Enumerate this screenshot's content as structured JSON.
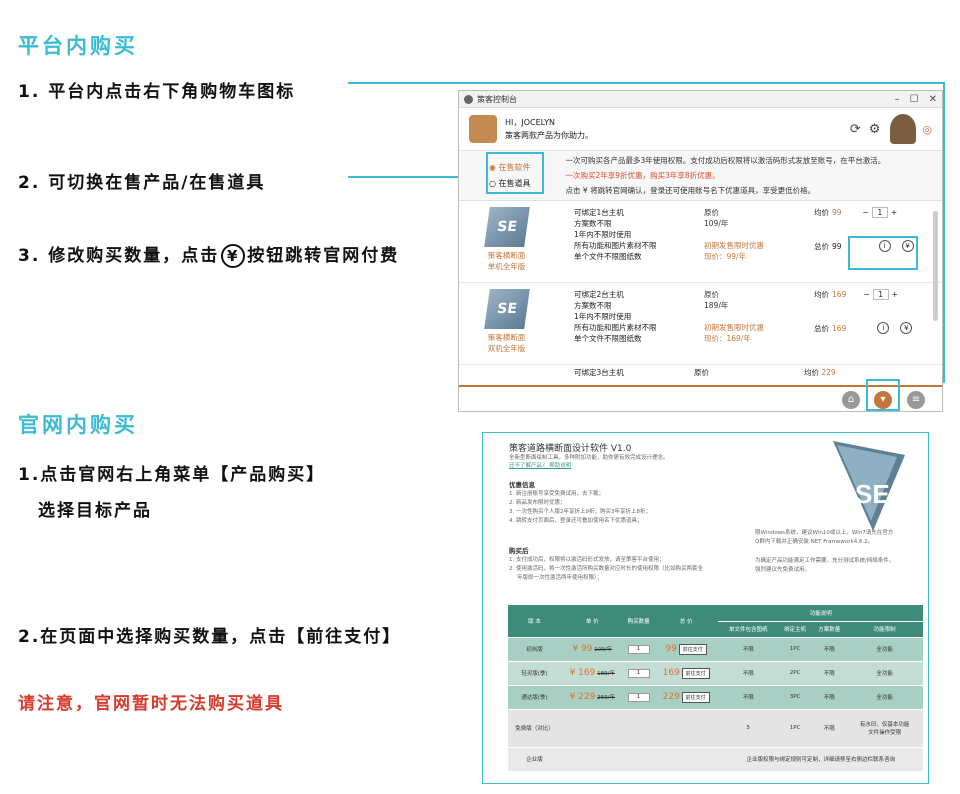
{
  "section1": {
    "title": "平台内购买",
    "step1": "1. 平台内点击右下角购物车图标",
    "step2": "2. 可切换在售产品/在售道具",
    "step3_a": "3. 修改购买数量，点击",
    "step3_yen": "¥",
    "step3_b": "按钮跳转官网付费"
  },
  "section2": {
    "title": "官网内购买",
    "step1_a": "1.点击官网右上角菜单【产品购买】",
    "step1_b": "选择目标产品",
    "step2": "2.在页面中选择购买数量，点击【前往支付】",
    "warning": "请注意，官网暂时无法购买道具"
  },
  "app": {
    "window_title": "策客控制台",
    "greeting": "HI，JOCELYN",
    "greeting_sub": "策客两款产品为你助力。",
    "modes": [
      "在售软件",
      "在售道具"
    ],
    "desc_line1": "一次可购买各产品最多3年使用权限。支付成功后权限将以激活码形式发放至账号，在平台激活。",
    "desc_line2": "一次购买2年享9折优惠，购买3年享8折优惠。",
    "desc_line3": "点击 ¥ 将跳转官网确认，登录还可使用账号名下优惠道具，享受更低价格。",
    "products": [
      {
        "name": "策客横断面\n单机全年版",
        "f1": "可绑定1台主机",
        "f2": "方案数不限",
        "f3": "1年内不限时使用",
        "f4": "所有功能和图片素材不限",
        "f5": "单个文件不限图纸数",
        "orig_label": "原价",
        "orig": "109/年",
        "promo_label": "初期发售限时优惠",
        "promo": "现价：99/年",
        "avg_label": "均价",
        "avg": "99",
        "total_label": "总价",
        "total": "99",
        "qty": "1"
      },
      {
        "name": "策客横断面\n双机全年版",
        "f1": "可绑定2台主机",
        "f2": "方案数不限",
        "f3": "1年内不限时使用",
        "f4": "所有功能和图片素材不限",
        "f5": "单个文件不限图纸数",
        "orig_label": "原价",
        "orig": "189/年",
        "promo_label": "初期发售限时优惠",
        "promo": "现价：169/年",
        "avg_label": "均价",
        "avg": "169",
        "total_label": "总价",
        "total": "169",
        "qty": "1"
      }
    ],
    "partial_row": {
      "f1": "可绑定3台主机",
      "orig_label": "原价",
      "avg_label": "均价",
      "avg": "229"
    }
  },
  "web": {
    "title": "策客道路横断面设计软件 V1.0",
    "sub1": "全新型断面绘制工具，多种附加功能，助你更有效完成设计理念。",
    "sub2": "还不了解产品？ 帮助说明",
    "sec_offer": "优惠信息",
    "offer": [
      "1. 新注册账号享受免费试用，去下载；",
      "2. 新品发布限时优惠；",
      "3. 一次性购买个人版2年享折上9折，购买3年享折上8折；",
      "4. 跳转支付页面后，登录还可叠加使用名下优惠道具；"
    ],
    "sec_after": "购买后",
    "after": [
      "1. 支付成功后，权限将以激活码形式发放，请至策客平台使用；",
      "2. 使用激活码，将一次性激活所购买数量对应时长的使用权限（比如购买两套全",
      "年版即一次性激活两年使用权限）；"
    ],
    "right1": "限Windows系统，建议Win10或以上，Win7请先在官方",
    "right2": "Q群内下载并正确安装.NET Framework4.6.2。",
    "right3": "为确定产品功能满足工作需要，充分测试系统/网络条件，",
    "right4": "强烈建议先免费试用。",
    "logo_text": "SE",
    "table": {
      "headers": [
        "版 本",
        "单 价",
        "购买数量",
        "总 价",
        "功能说明",
        "单文件包含图纸",
        "绑定主机",
        "方案数量",
        "功能限制"
      ],
      "rows": [
        {
          "ver": "初岚版",
          "price": "¥ 99",
          "orig": "109/年",
          "qty": "1",
          "total": "99",
          "pay": "前往支付",
          "sheets": "不限",
          "host": "1PC",
          "plans": "不限",
          "limit": "全功能"
        },
        {
          "ver": "轻灵版(季)",
          "price": "¥ 169",
          "orig": "189/年",
          "qty": "1",
          "total": "169",
          "pay": "前往支付",
          "sheets": "不限",
          "host": "2PC",
          "plans": "不限",
          "limit": "全功能"
        },
        {
          "ver": "通达版(季)",
          "price": "¥ 229",
          "orig": "259/年",
          "qty": "1",
          "total": "229",
          "pay": "前往支付",
          "sheets": "不限",
          "host": "3PC",
          "plans": "不限",
          "limit": "全功能"
        }
      ],
      "free": {
        "ver": "免费版（对比）",
        "sheets": "5",
        "host": "1PC",
        "plans": "不限",
        "limit1": "有水印、仅基本功能",
        "limit2": "文件操作受限"
      },
      "ent": {
        "ver": "企业版",
        "note": "企业版权限与绑定规则可定制，详细请移至右侧边栏联系咨询"
      }
    }
  }
}
